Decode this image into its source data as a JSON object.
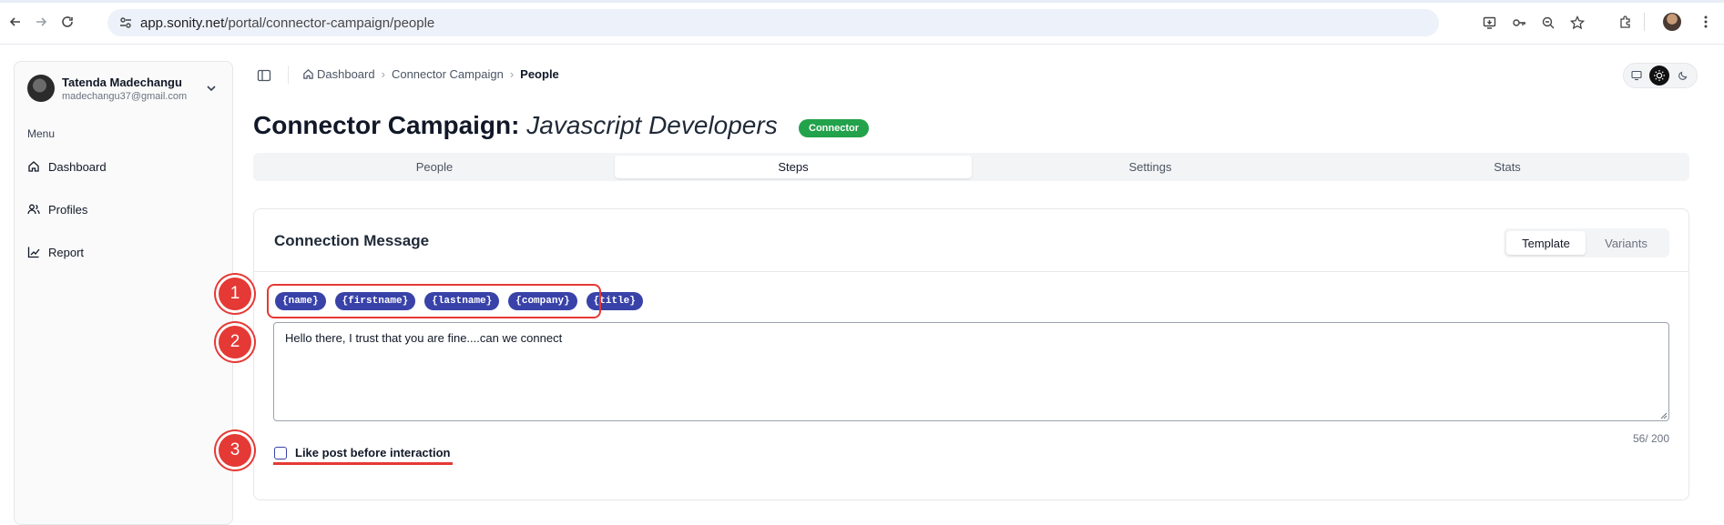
{
  "browser": {
    "url_host": "app.sonity.net",
    "url_path": "/portal/connector-campaign/people"
  },
  "sidebar": {
    "user_name": "Tatenda Madechangu",
    "user_email": "madechangu37@gmail.com",
    "menu_label": "Menu",
    "items": [
      {
        "label": "Dashboard",
        "icon": "home-icon"
      },
      {
        "label": "Profiles",
        "icon": "users-icon"
      },
      {
        "label": "Report",
        "icon": "chart-icon"
      }
    ]
  },
  "breadcrumb": {
    "items": [
      "Dashboard",
      "Connector Campaign"
    ],
    "current": "People"
  },
  "header": {
    "title_prefix": "Connector Campaign:",
    "campaign_name": "Javascript Developers",
    "badge": "Connector",
    "badge_color": "#22a24a"
  },
  "tabs": [
    {
      "label": "People",
      "active": false
    },
    {
      "label": "Steps",
      "active": true
    },
    {
      "label": "Settings",
      "active": false
    },
    {
      "label": "Stats",
      "active": false
    }
  ],
  "card": {
    "title": "Connection Message",
    "toggle": [
      {
        "label": "Template",
        "active": true
      },
      {
        "label": "Variants",
        "active": false
      }
    ],
    "variables": [
      "{name}",
      "{firstname}",
      "{lastname}",
      "{company}",
      "{title}"
    ],
    "message": "Hello there, I trust that you are fine....can we connect",
    "char_count": "56/ 200",
    "like_post_label": "Like post before interaction",
    "like_post_checked": false
  },
  "annotations": {
    "markers": [
      "1",
      "2",
      "3"
    ],
    "color": "#e53935"
  },
  "colors": {
    "accent": "#3942a8"
  }
}
